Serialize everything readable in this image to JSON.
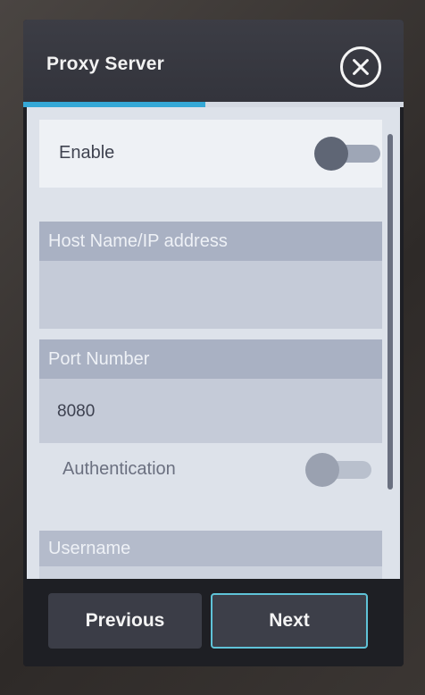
{
  "header": {
    "title": "Proxy Server",
    "close_icon": "close-circle-icon"
  },
  "progress": {
    "fraction": 0.48,
    "color": "#35a8d6"
  },
  "settings": {
    "enable": {
      "label": "Enable",
      "on": false
    },
    "host": {
      "label": "Host Name/IP address",
      "value": ""
    },
    "port": {
      "label": "Port Number",
      "value": "8080"
    },
    "authentication": {
      "label": "Authentication",
      "on": false
    },
    "username": {
      "label": "Username",
      "value": ""
    }
  },
  "footer": {
    "previous_label": "Previous",
    "next_label": "Next"
  },
  "colors": {
    "accent": "#35a8d6",
    "header_bg": "#3c3d45",
    "panel_bg": "#dde2ea"
  }
}
